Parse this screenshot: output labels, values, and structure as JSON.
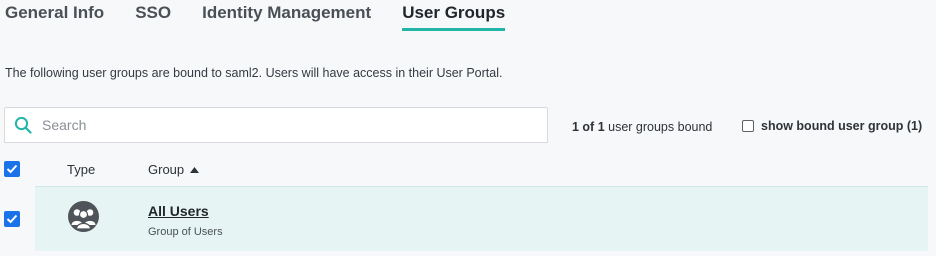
{
  "tabs": [
    {
      "label": "General Info"
    },
    {
      "label": "SSO"
    },
    {
      "label": "Identity Management"
    },
    {
      "label": "User Groups",
      "active": true
    }
  ],
  "description": "The following user groups are bound to saml2. Users will have access in their User Portal.",
  "search": {
    "placeholder": "Search",
    "value": ""
  },
  "count": {
    "bold": "1 of 1",
    "rest": " user groups bound"
  },
  "show_bound": {
    "label": "show bound user group (1)",
    "checked": false
  },
  "table": {
    "select_all_checked": true,
    "columns": {
      "type": "Type",
      "group": "Group"
    },
    "sort": "ascending",
    "rows": [
      {
        "checked": true,
        "icon": "user-group-icon",
        "name": "All Users",
        "subtitle": "Group of Users"
      }
    ]
  },
  "colors": {
    "accent_teal": "#23b6a6",
    "checkbox_blue": "#1a73e8",
    "row_highlight": "#e6f5f3"
  }
}
